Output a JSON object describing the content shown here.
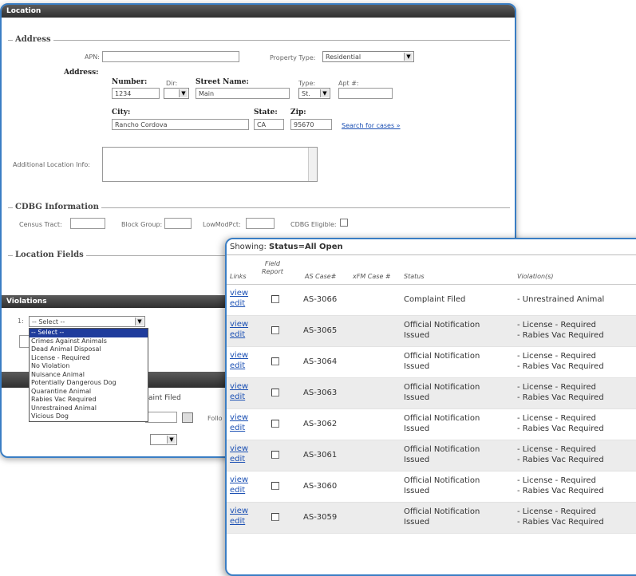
{
  "location_panel": {
    "title": "Location",
    "address_legend": "Address",
    "apn_label": "APN:",
    "apn_value": "",
    "property_type_label": "Property Type:",
    "property_type_value": "Residential",
    "address_label": "Address:",
    "number_label": "Number:",
    "number_value": "1234",
    "dir_label": "Dir:",
    "dir_value": "",
    "street_name_label": "Street Name:",
    "street_name_value": "Main",
    "type_label": "Type:",
    "type_value": "St.",
    "apt_label": "Apt #:",
    "apt_value": "",
    "city_label": "City:",
    "city_value": "Rancho Cordova",
    "state_label": "State:",
    "state_value": "CA",
    "zip_label": "Zip:",
    "zip_value": "95670",
    "search_link": "Search for cases »",
    "additional_info_label": "Additional Location Info:",
    "cdbg_legend": "CDBG Information",
    "census_tract_label": "Census Tract:",
    "block_group_label": "Block Group:",
    "lowmod_label": "LowModPct:",
    "cdbg_eligible_label": "CDBG Eligible:",
    "location_fields_legend": "Location Fields"
  },
  "violations_panel": {
    "title": "Violations",
    "select_value": "-- Select --",
    "options": [
      "-- Select --",
      "Crimes Against Animals",
      "Dead Animal Disposal",
      "License - Required",
      "No Violation",
      "Nuisance Animal",
      "Potentially Dangerous Dog",
      "Quarantine Animal",
      "Rabies Vac Required",
      "Unrestrained Animal",
      "Vicious Dog"
    ],
    "behind_text": "aint Filed",
    "behind_stub": "Follo"
  },
  "case_list": {
    "showing_prefix": "Showing: ",
    "showing_filter": "Status=All Open",
    "headers": {
      "links": "Links",
      "field_report": "Field\nReport",
      "as_case": "AS Case#",
      "xfm_case": "xFM Case #",
      "status": "Status",
      "violations": "Violation(s)"
    },
    "view_label": "view",
    "edit_label": "edit",
    "rows": [
      {
        "case": "AS-3066",
        "status1": "Complaint Filed",
        "status2": "",
        "viol1": "- Unrestrained Animal",
        "viol2": ""
      },
      {
        "case": "AS-3065",
        "status1": "Official Notification",
        "status2": "Issued",
        "viol1": "- License - Required",
        "viol2": "- Rabies Vac Required"
      },
      {
        "case": "AS-3064",
        "status1": "Official Notification",
        "status2": "Issued",
        "viol1": "- License - Required",
        "viol2": "- Rabies Vac Required"
      },
      {
        "case": "AS-3063",
        "status1": "Official Notification",
        "status2": "Issued",
        "viol1": "- License - Required",
        "viol2": "- Rabies Vac Required"
      },
      {
        "case": "AS-3062",
        "status1": "Official Notification",
        "status2": "Issued",
        "viol1": "- License - Required",
        "viol2": "- Rabies Vac Required"
      },
      {
        "case": "AS-3061",
        "status1": "Official Notification",
        "status2": "Issued",
        "viol1": "- License - Required",
        "viol2": "- Rabies Vac Required"
      },
      {
        "case": "AS-3060",
        "status1": "Official Notification",
        "status2": "Issued",
        "viol1": "- License - Required",
        "viol2": "- Rabies Vac Required"
      },
      {
        "case": "AS-3059",
        "status1": "Official Notification",
        "status2": "Issued",
        "viol1": "- License - Required",
        "viol2": "- Rabies Vac Required"
      }
    ]
  }
}
